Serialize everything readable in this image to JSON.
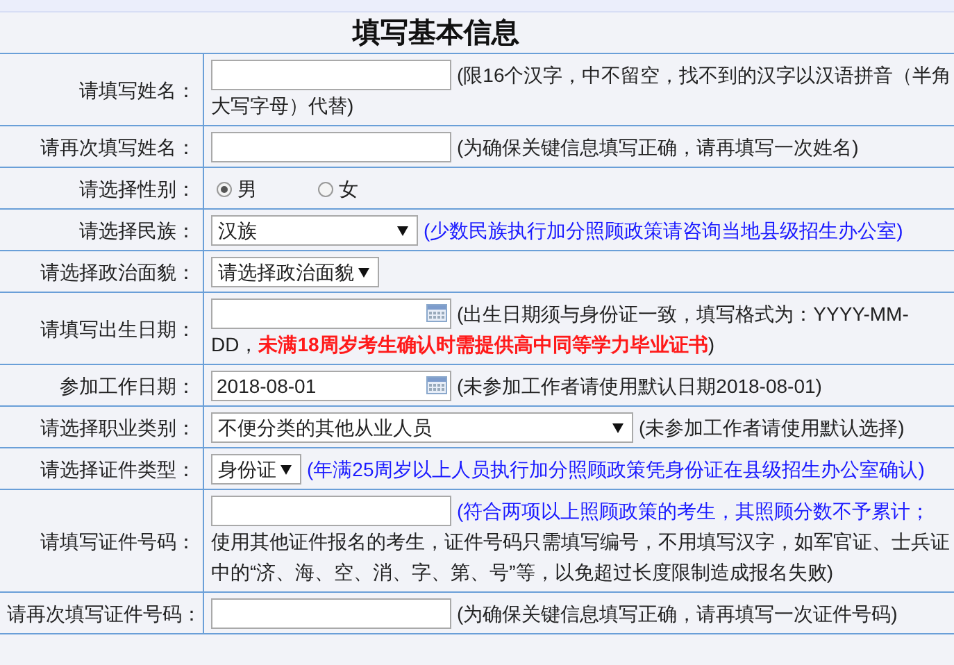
{
  "title": "填写基本信息",
  "rows": [
    {
      "label": "请填写姓名：",
      "kind": "text",
      "hint_lines": [
        [
          {
            "kind": "note",
            "text": "(限16个汉字，中不留空，找不到的汉字以汉语拼音（半角"
          }
        ],
        [
          {
            "kind": "note",
            "text": "大写字母）代替)"
          }
        ]
      ]
    },
    {
      "label": "请再次填写姓名：",
      "kind": "text",
      "hint_lines": [
        [
          {
            "kind": "note",
            "text": "(为确保关键信息填写正确，请再填写一次姓名)"
          }
        ]
      ]
    },
    {
      "label": "请选择性别：",
      "kind": "radio",
      "options": [
        {
          "label": "男",
          "selected": true
        },
        {
          "label": "女",
          "selected": false
        }
      ]
    },
    {
      "label": "请选择民族：",
      "kind": "select",
      "value": "汉族",
      "hint_lines": [
        [
          {
            "kind": "policy",
            "text": "(少数民族执行加分照顾政策请咨询当地县级招生办公室)"
          }
        ]
      ]
    },
    {
      "label": "请选择政治面貌：",
      "kind": "select",
      "value": "请选择政治面貌"
    },
    {
      "label": "请填写出生日期：",
      "kind": "date",
      "hint_lines": [
        [
          {
            "kind": "note",
            "text": "(出生日期须与身份证一致，填写格式为：YYYY-MM-"
          }
        ],
        [
          {
            "kind": "note",
            "text": "DD，"
          },
          {
            "kind": "warning",
            "text": "未满18周岁考生确认时需提供高中同等学力毕业证书"
          },
          {
            "kind": "note",
            "text": ")"
          }
        ]
      ]
    },
    {
      "label": "参加工作日期：",
      "kind": "date",
      "value": "2018-08-01",
      "hint_lines": [
        [
          {
            "kind": "note",
            "text": "(未参加工作者请使用默认日期2018-08-01)"
          }
        ]
      ]
    },
    {
      "label": "请选择职业类别：",
      "kind": "select",
      "value": "不便分类的其他从业人员",
      "hint_lines": [
        [
          {
            "kind": "note",
            "text": "(未参加工作者请使用默认选择)"
          }
        ]
      ]
    },
    {
      "label": "请选择证件类型：",
      "kind": "select",
      "value": "身份证",
      "hint_lines": [
        [
          {
            "kind": "policy",
            "text": "(年满25周岁以上人员执行加分照顾政策凭身份证在县级招生办公室确认)"
          }
        ]
      ]
    },
    {
      "label": "请填写证件号码：",
      "kind": "text",
      "hint_lines": [
        [
          {
            "kind": "policy",
            "text": "(符合两项以上照顾政策的考生，其照顾分数不予累计；"
          }
        ],
        [
          {
            "kind": "note",
            "text": "使用其他证件报名的考生，证件号码只需填写编号，不用填写汉字，如军官证、士兵证"
          }
        ],
        [
          {
            "kind": "note",
            "text": "中的“济、海、空、消、字、第、号”等，以免超过长度限制造成报名失败)"
          }
        ]
      ]
    },
    {
      "label": "请再次填写证件号码：",
      "kind": "text",
      "hint_lines": [
        [
          {
            "kind": "note",
            "text": "(为确保关键信息填写正确，请再填写一次证件号码)"
          }
        ]
      ]
    }
  ]
}
